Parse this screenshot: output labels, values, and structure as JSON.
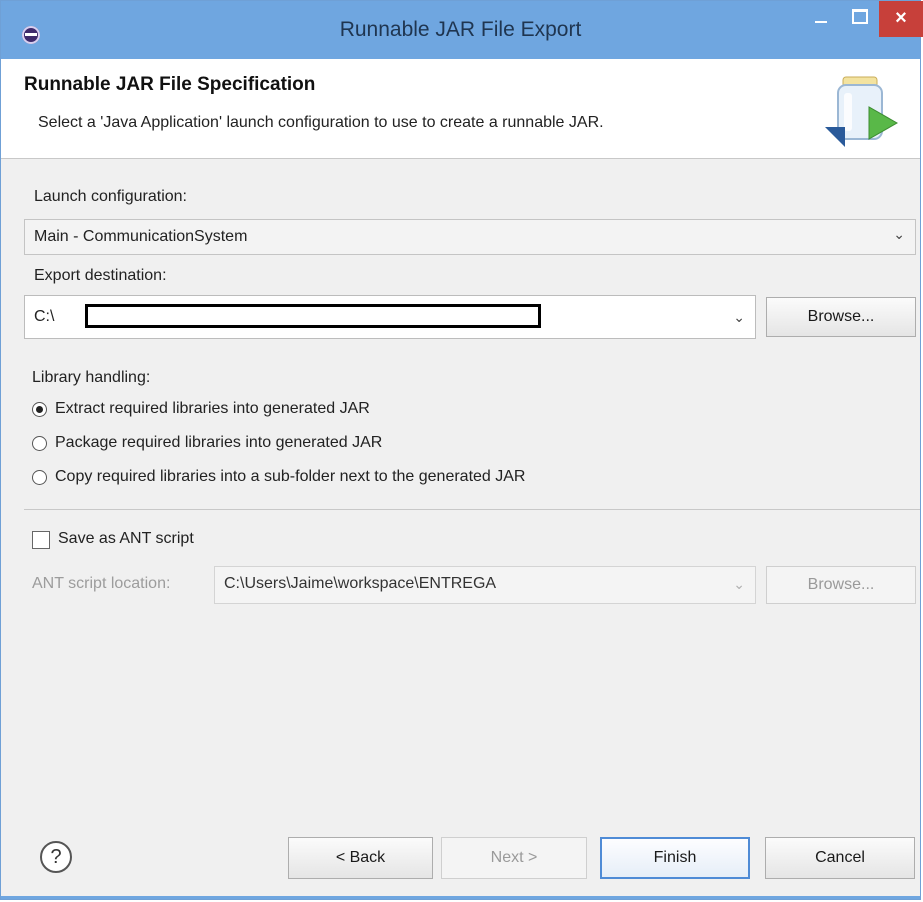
{
  "window": {
    "title": "Runnable JAR File Export",
    "close_glyph": "×"
  },
  "header": {
    "title": "Runnable JAR File Specification",
    "description": "Select a 'Java Application' launch configuration to use to create a runnable JAR."
  },
  "launch": {
    "label": "Launch configuration:",
    "value": "Main - CommunicationSystem"
  },
  "destination": {
    "label": "Export destination:",
    "value_prefix": "C:\\",
    "browse_label": "Browse..."
  },
  "library": {
    "label": "Library handling:",
    "options": [
      {
        "label": "Extract required libraries into generated JAR",
        "selected": true
      },
      {
        "label": "Package required libraries into generated JAR",
        "selected": false
      },
      {
        "label": "Copy required libraries into a sub-folder next to the generated JAR",
        "selected": false
      }
    ]
  },
  "ant": {
    "checkbox_label": "Save as ANT script",
    "checked": false,
    "location_label": "ANT script location:",
    "location_value": "C:\\Users\\Jaime\\workspace\\ENTREGA",
    "browse_label": "Browse..."
  },
  "footer": {
    "help_glyph": "?",
    "back_label": "< Back",
    "next_label": "Next >",
    "finish_label": "Finish",
    "cancel_label": "Cancel"
  },
  "dropdown_glyph": "⌄",
  "colors": {
    "titlebar": "#6fa6e0",
    "close_button": "#c7403a",
    "dialog_bg": "#f0f0f0",
    "header_bg": "#ffffff",
    "default_button_border": "#4f8bd6"
  }
}
